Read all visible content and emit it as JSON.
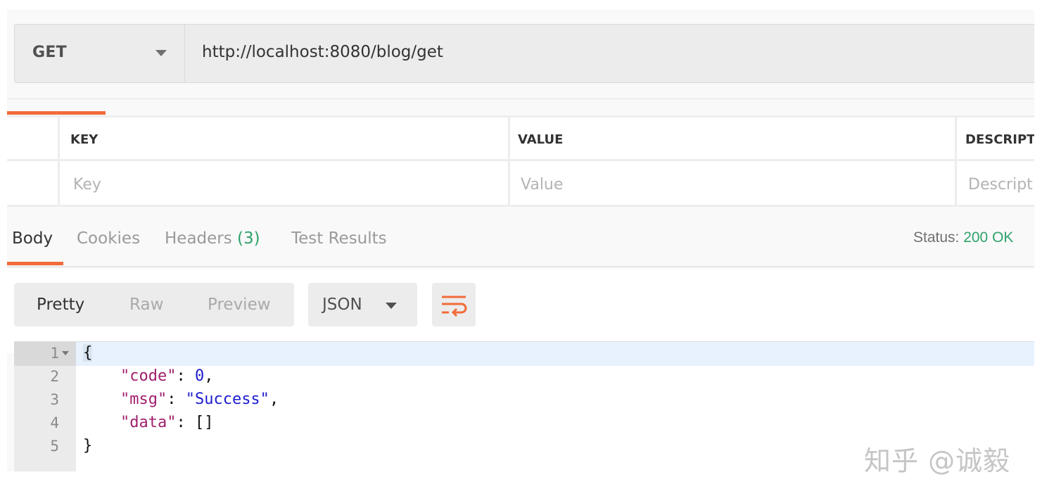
{
  "request": {
    "method": "GET",
    "url": "http://localhost:8080/blog/get"
  },
  "params_table": {
    "headers": [
      "KEY",
      "VALUE",
      "DESCRIPT"
    ],
    "placeholders": [
      "Key",
      "Value",
      "Descript"
    ]
  },
  "response_tabs": [
    {
      "label": "Body",
      "active": true
    },
    {
      "label": "Cookies"
    },
    {
      "label": "Headers ",
      "count": "(3)"
    },
    {
      "label": "Test Results"
    }
  ],
  "status": {
    "label": "Status: ",
    "value": "200 OK",
    "color": "#2fa36b"
  },
  "body_view": {
    "modes": [
      "Pretty",
      "Raw",
      "Preview"
    ],
    "active_mode": "Pretty",
    "format": "JSON",
    "wrap_icon": "wrap-lines-icon"
  },
  "code": {
    "line_numbers": [
      "1",
      "2",
      "3",
      "4",
      "5"
    ],
    "tokens": {
      "open": "{",
      "code_key": "\"code\"",
      "code_val": "0",
      "msg_key": "\"msg\"",
      "msg_val": "\"Success\"",
      "data_key": "\"data\"",
      "data_val": "[]",
      "close": "}"
    }
  },
  "watermark": "知乎 @诚毅",
  "colors": {
    "accent": "#f26b3a",
    "key_color": "#a0206e",
    "value_color": "#1c1ccf"
  }
}
